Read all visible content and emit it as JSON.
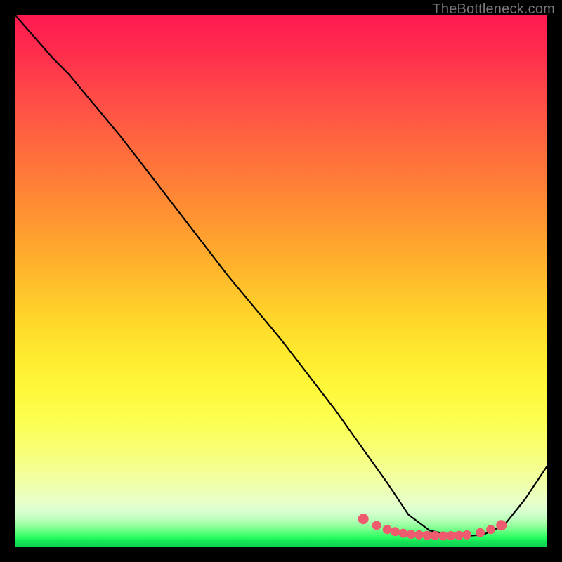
{
  "attribution": "TheBottleneck.com",
  "colors": {
    "curve": "#000000",
    "marker_fill": "#ef5b6e",
    "marker_stroke": "#ef5b6e"
  },
  "chart_data": {
    "type": "line",
    "title": "",
    "xlabel": "",
    "ylabel": "",
    "xlim": [
      0,
      100
    ],
    "ylim": [
      0,
      100
    ],
    "grid": false,
    "legend": false,
    "series": [
      {
        "name": "bottleneck-curve",
        "x": [
          0,
          7,
          10,
          20,
          30,
          40,
          50,
          60,
          65,
          70,
          74,
          78,
          82,
          85,
          88,
          92,
          96,
          100
        ],
        "y": [
          100,
          92,
          89,
          77,
          64,
          51,
          39,
          26,
          19,
          12,
          6,
          3,
          2.2,
          2,
          2.2,
          4,
          9,
          15
        ]
      }
    ],
    "markers": {
      "name": "highlight-dots",
      "x": [
        65.5,
        68,
        70,
        71.5,
        73,
        74.5,
        76,
        77.5,
        79,
        80.5,
        82,
        83.5,
        85,
        87.5,
        89.5,
        91.5
      ],
      "y": [
        5.2,
        4.0,
        3.2,
        2.8,
        2.5,
        2.3,
        2.2,
        2.1,
        2.05,
        2.0,
        2.05,
        2.1,
        2.2,
        2.6,
        3.2,
        4.0
      ]
    }
  }
}
